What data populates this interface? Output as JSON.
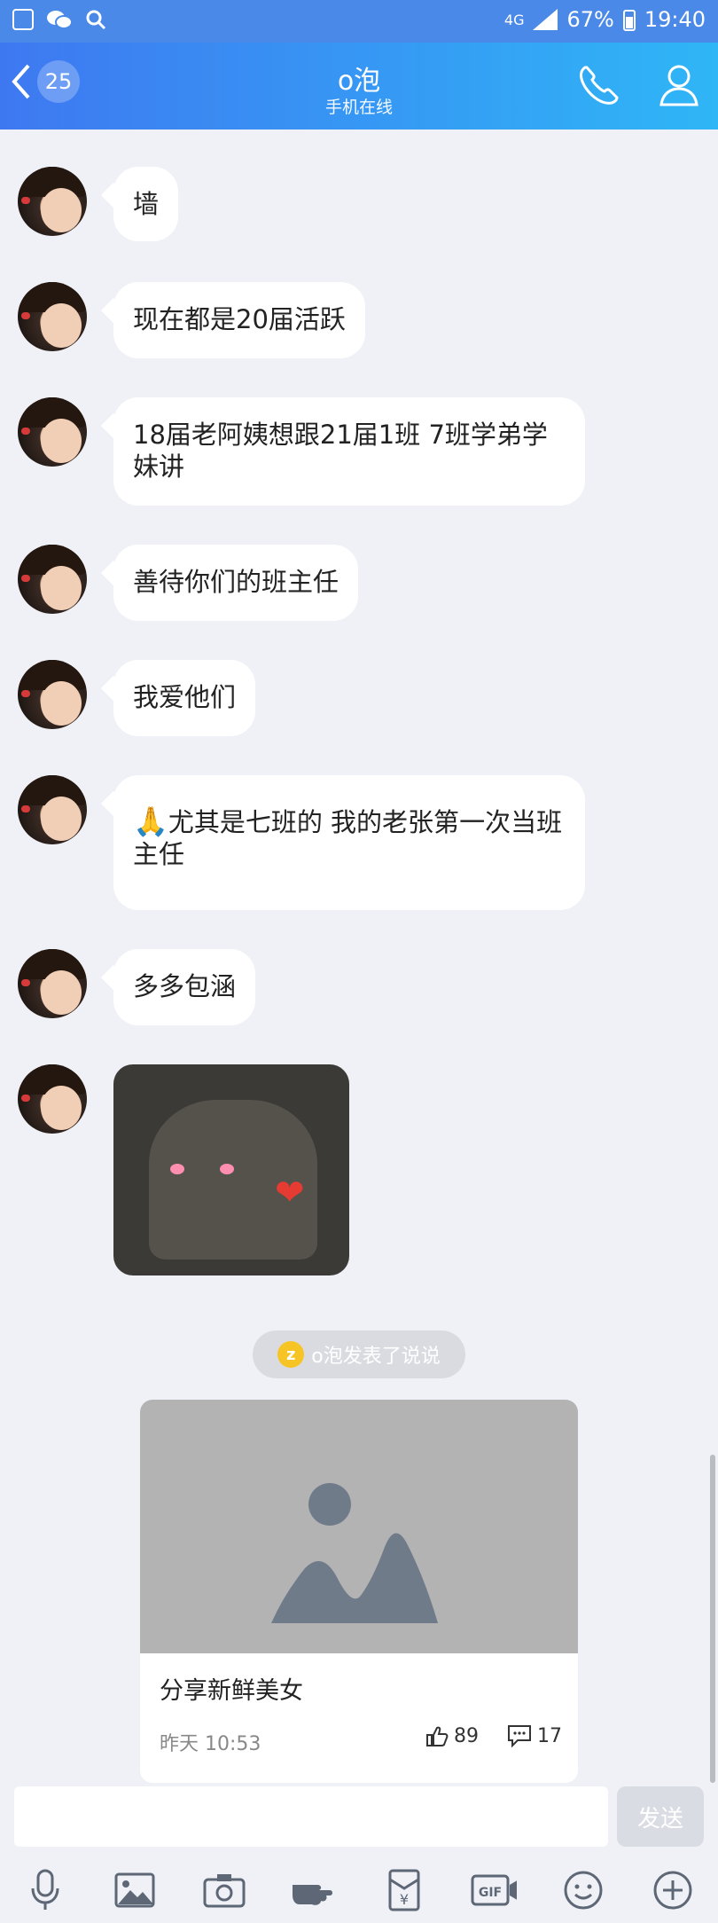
{
  "status_bar": {
    "battery": "67%",
    "time": "19:40",
    "network": "4G"
  },
  "header": {
    "badge_count": "25",
    "title": "o泡",
    "subtitle": "手机在线"
  },
  "messages": [
    {
      "text": "墙"
    },
    {
      "text": "现在都是20届活跃"
    },
    {
      "text": "18届老阿姨想跟21届1班 7班学弟学妹讲"
    },
    {
      "text": "善待你们的班主任"
    },
    {
      "text": "我爱他们"
    },
    {
      "emoji": "🙏",
      "text": "尤其是七班的 我的老张第一次当班主任"
    },
    {
      "text": "多多包涵"
    }
  ],
  "system_notice": "o泡发表了说说",
  "share_card": {
    "title": "分享新鲜美女",
    "time": "昨天 10:53",
    "likes": "89",
    "comments": "17"
  },
  "composer": {
    "send_label": "发送",
    "placeholder": ""
  },
  "toolbar": {
    "items": [
      "mic-icon",
      "image-icon",
      "camera-icon",
      "hand-icon",
      "red-packet-icon",
      "gif-icon",
      "emoji-icon",
      "plus-icon"
    ]
  },
  "colors": {
    "header_start": "#3e78f1",
    "header_end": "#2fb6f6",
    "background": "#eff1f6"
  }
}
